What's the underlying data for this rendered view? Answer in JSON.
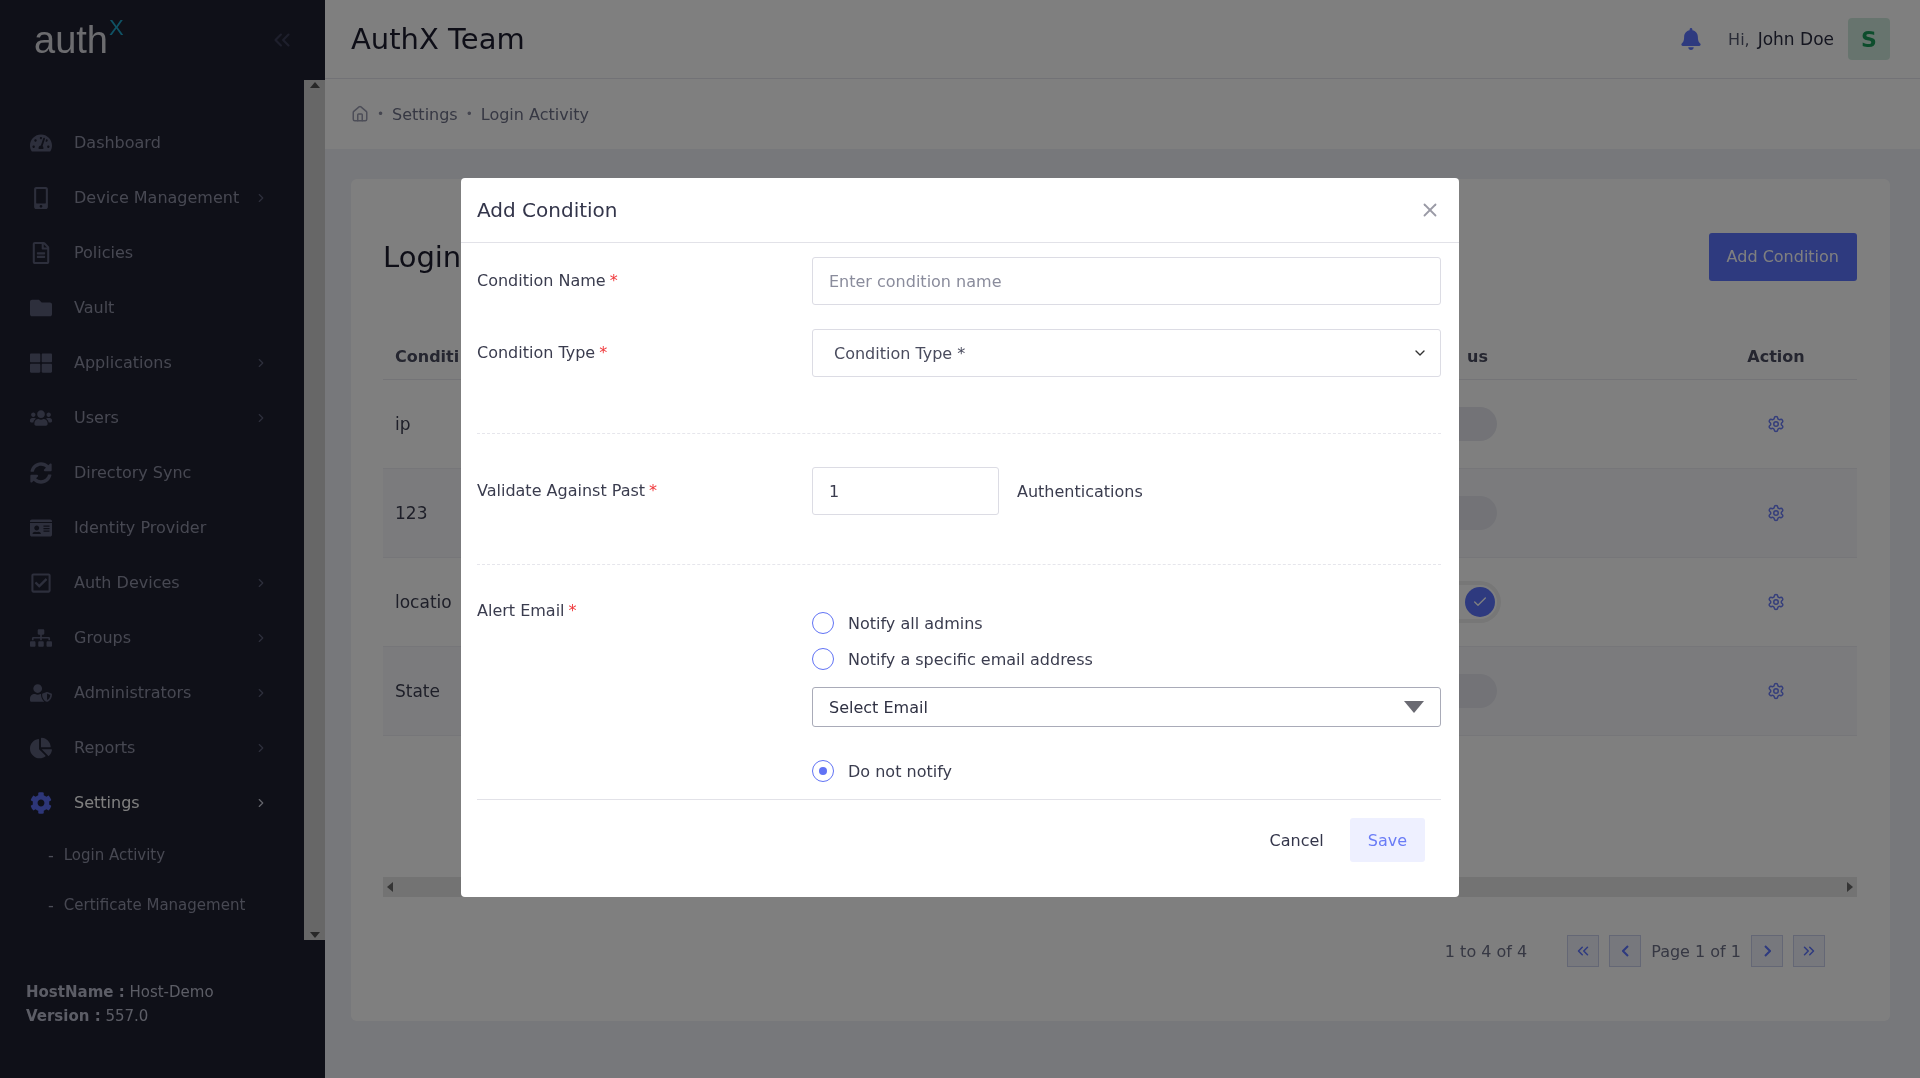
{
  "sidebar": {
    "logo": {
      "text": "auth",
      "mark": "X"
    },
    "items": [
      {
        "label": "Dashboard",
        "expandable": false,
        "selected": false
      },
      {
        "label": "Device Management",
        "expandable": true,
        "selected": false
      },
      {
        "label": "Policies",
        "expandable": false,
        "selected": false
      },
      {
        "label": "Vault",
        "expandable": false,
        "selected": false
      },
      {
        "label": "Applications",
        "expandable": true,
        "selected": false
      },
      {
        "label": "Users",
        "expandable": true,
        "selected": false
      },
      {
        "label": "Directory Sync",
        "expandable": false,
        "selected": false
      },
      {
        "label": "Identity Provider",
        "expandable": false,
        "selected": false
      },
      {
        "label": "Auth Devices",
        "expandable": true,
        "selected": false
      },
      {
        "label": "Groups",
        "expandable": true,
        "selected": false
      },
      {
        "label": "Administrators",
        "expandable": true,
        "selected": false
      },
      {
        "label": "Reports",
        "expandable": true,
        "selected": false
      },
      {
        "label": "Settings",
        "expandable": true,
        "selected": true,
        "children": [
          {
            "bullet": "-",
            "label": "Login Activity",
            "selected": false
          },
          {
            "bullet": "-",
            "label": "Certificate Management",
            "selected": false
          }
        ]
      }
    ],
    "footer": [
      {
        "key": "HostName :",
        "value": "Host-Demo"
      },
      {
        "key": "Version :",
        "value": "557.0"
      }
    ]
  },
  "header": {
    "title": "AuthX Team",
    "greeting": "Hi,",
    "user": "John Doe",
    "avatar": "S"
  },
  "breadcrumb": [
    {
      "separator": "•",
      "label": "Settings"
    },
    {
      "separator": "•",
      "label": "Login Activity"
    }
  ],
  "card": {
    "title": "Login",
    "add_button": "Add Condition",
    "columns": [
      "Conditi",
      "us",
      "Action"
    ],
    "rows": [
      {
        "name": "ip",
        "on": false
      },
      {
        "name": "123",
        "on": false
      },
      {
        "name": "locatio",
        "on": true
      },
      {
        "name": "State",
        "on": false
      }
    ],
    "pagination": {
      "summary": "1 to 4 of 4",
      "page": "Page 1 of 1"
    }
  },
  "modal": {
    "title": "Add Condition",
    "name_field": {
      "label": "Condition Name",
      "required_mark": "*",
      "placeholder": "Enter condition name"
    },
    "type_field": {
      "label": "Condition Type",
      "required_mark": "*",
      "placeholder": "Condition Type *"
    },
    "past_field": {
      "label": "Validate Against Past",
      "required_mark": "*",
      "value": "1",
      "suffix": "Authentications"
    },
    "alert": {
      "label": "Alert Email",
      "required_mark": "*",
      "options": [
        {
          "label": "Notify all admins",
          "selected": false
        },
        {
          "label": "Notify a specific email address",
          "selected": false
        },
        {
          "label": "Do not notify",
          "selected": true
        }
      ],
      "email_select": "Select Email"
    },
    "buttons": {
      "cancel": "Cancel",
      "save": "Save"
    }
  }
}
